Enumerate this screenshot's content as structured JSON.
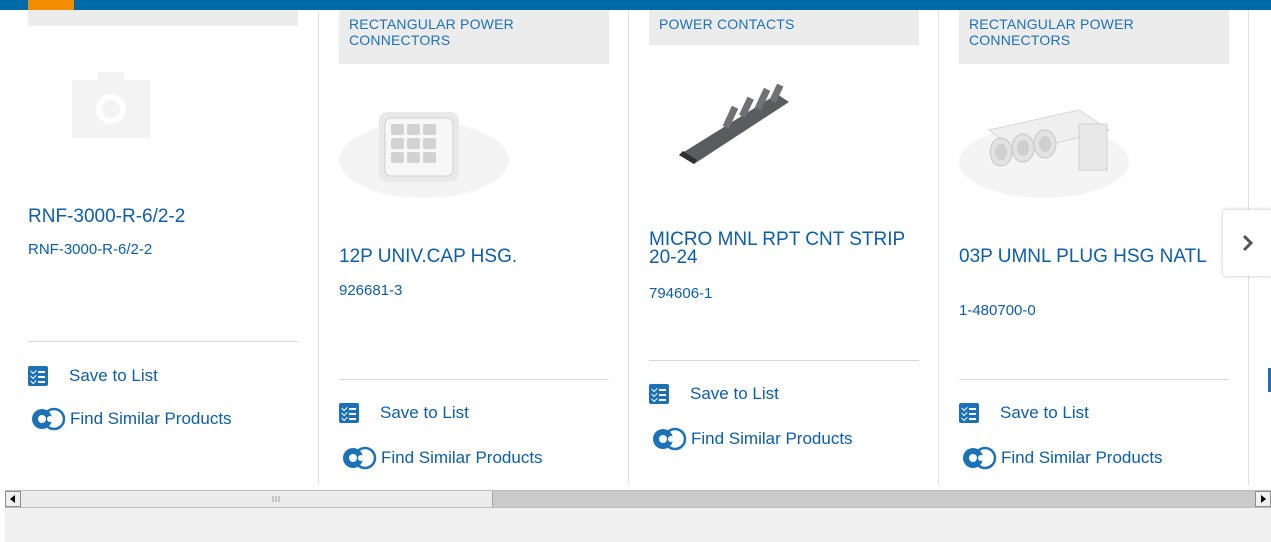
{
  "products": [
    {
      "category": "",
      "title": "RNF-3000-R-6/2-2",
      "part_number": "RNF-3000-R-6/2-2",
      "image": "placeholder-camera-icon",
      "save_label": "Save to List",
      "similar_label": "Find Similar Products"
    },
    {
      "category": "RECTANGULAR POWER CONNECTORS",
      "title": "12P UNIV.CAP HSG.",
      "part_number": "926681-3",
      "image": "white-12-pin-connector-housing",
      "save_label": "Save to List",
      "similar_label": "Find Similar Products"
    },
    {
      "category": "POWER CONTACTS",
      "title": "MICRO MNL RPT CNT STRIP 20-24",
      "part_number": "794606-1",
      "image": "metal-crimp-contact",
      "save_label": "Save to List",
      "similar_label": "Find Similar Products"
    },
    {
      "category": "RECTANGULAR POWER CONNECTORS",
      "title": "03P UMNL PLUG HSG NATL",
      "part_number": "1-480700-0",
      "image": "white-3-pin-plug-housing",
      "save_label": "Save to List",
      "similar_label": "Find Similar Products"
    }
  ],
  "carousel": {
    "next_icon": "chevron-right-icon"
  },
  "colors": {
    "brand_blue": "#0b5ea8",
    "accent_orange": "#f28d00",
    "topbar_blue": "#0069a8"
  }
}
